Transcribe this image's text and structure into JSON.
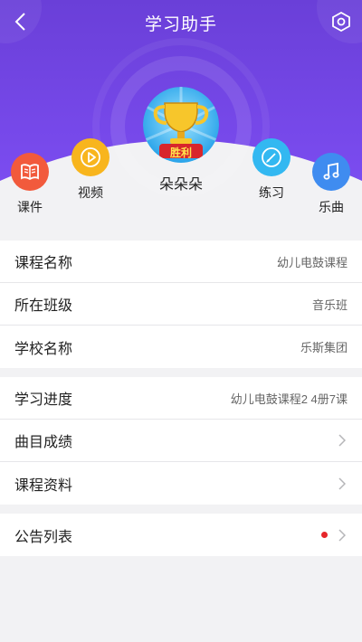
{
  "header": {
    "title": "学习助手",
    "gradient_top": "#6a3fd8",
    "gradient_bottom": "#7b4cf0"
  },
  "profile": {
    "name": "朵朵朵",
    "badge_text": "胜利"
  },
  "nav": {
    "courseware": {
      "label": "课件",
      "icon": "book-icon",
      "color": "#f25a3c"
    },
    "video": {
      "label": "视频",
      "icon": "play-icon",
      "color": "#f8b51d"
    },
    "practice": {
      "label": "练习",
      "icon": "pen-icon",
      "color": "#33b8f1"
    },
    "music": {
      "label": "乐曲",
      "icon": "music-note-icon",
      "color": "#3f8cf0"
    }
  },
  "info": [
    {
      "label": "课程名称",
      "value": "幼儿电鼓课程"
    },
    {
      "label": "所在班级",
      "value": "音乐班"
    },
    {
      "label": "学校名称",
      "value": "乐斯集团"
    }
  ],
  "study": [
    {
      "label": "学习进度",
      "value": "幼儿电鼓课程2 4册7课"
    },
    {
      "label": "曲目成绩"
    },
    {
      "label": "课程资料"
    }
  ],
  "notice": {
    "label": "公告列表",
    "dot_color": "#e6262a"
  }
}
